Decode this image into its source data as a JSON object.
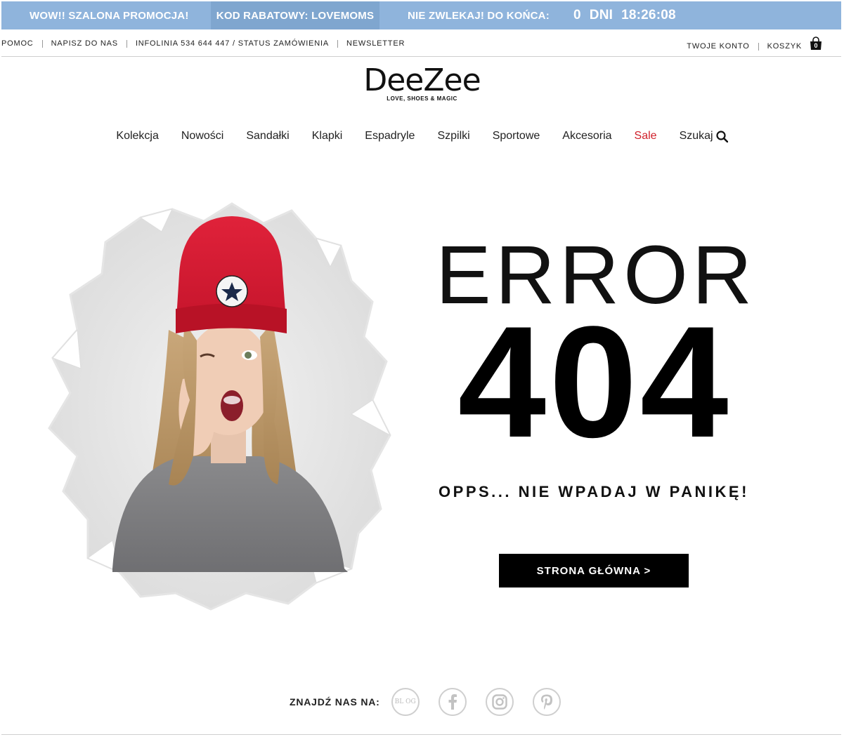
{
  "promo": {
    "seg1": "WOW!! SZALONA PROMOCJA!",
    "seg2": "KOD RABATOWY: LOVEMOMS",
    "seg3": "NIE ZWLEKAJ! DO KOŃCA:",
    "days": "0",
    "days_label": "DNI",
    "time": "18:26:08",
    "colors": {
      "bar": "#8fb4dc",
      "highlight": "#7fa6cf"
    }
  },
  "util": {
    "left": [
      {
        "label": "POMOC"
      },
      {
        "label": "NAPISZ DO NAS"
      },
      {
        "label": "INFOLINIA 534 644 447 / STATUS ZAMÓWIENIA"
      },
      {
        "label": "NEWSLETTER"
      }
    ],
    "account": "TWOJE KONTO",
    "cart": "KOSZYK",
    "cart_count": "0"
  },
  "logo": {
    "name": "DeeZee",
    "tagline": "LOVE, SHOES & MAGIC"
  },
  "nav": {
    "items": [
      "Kolekcja",
      "Nowości",
      "Sandałki",
      "Klapki",
      "Espadryle",
      "Szpilki",
      "Sportowe",
      "Akcesoria"
    ],
    "sale": "Sale",
    "search": "Szukaj",
    "sale_color": "#d0202a"
  },
  "error": {
    "word": "ERROR",
    "code": "404",
    "message": "OPPS... NIE WPADAJ W PANIKĘ!",
    "button": "STRONA GŁÓWNA >"
  },
  "social": {
    "label": "ZNAJDŹ NAS NA:",
    "icons": [
      "blog-icon",
      "facebook-icon",
      "instagram-icon",
      "pinterest-icon"
    ],
    "blog_text": "BL OG"
  }
}
